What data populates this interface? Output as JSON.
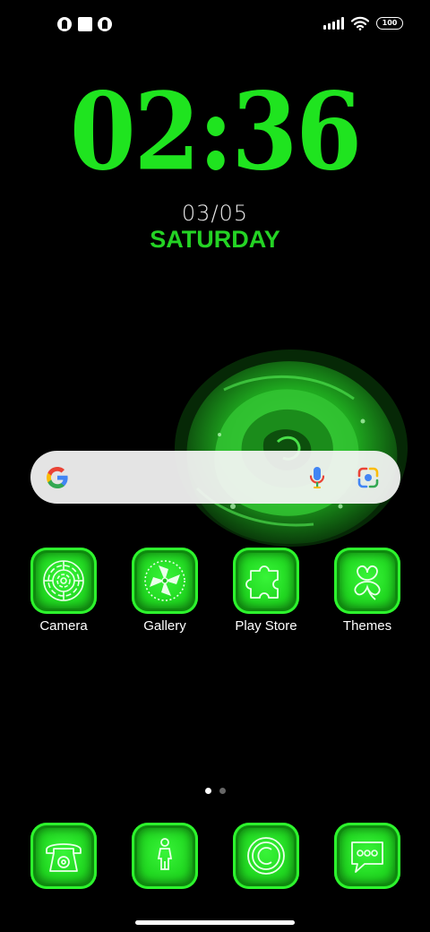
{
  "status_bar": {
    "battery_level": "100",
    "notification_icons": [
      "app-notification-icon",
      "square-notification-icon",
      "app-notification-icon"
    ],
    "signal_icon": "cellular-signal-icon",
    "wifi_icon": "wifi-icon"
  },
  "lockscreen_widget": {
    "time": "02:36",
    "date": "03/05",
    "weekday": "SATURDAY"
  },
  "search_widget": {
    "logo": "google-g-icon",
    "voice_icon": "microphone-icon",
    "lens_icon": "google-lens-icon"
  },
  "apps": [
    {
      "label": "Camera",
      "icon": "camera-icon"
    },
    {
      "label": "Gallery",
      "icon": "gallery-icon"
    },
    {
      "label": "Play Store",
      "icon": "puzzle-piece-icon"
    },
    {
      "label": "Themes",
      "icon": "clover-icon"
    }
  ],
  "dock": [
    {
      "icon": "phone-icon"
    },
    {
      "icon": "contacts-icon"
    },
    {
      "icon": "browser-icon"
    },
    {
      "icon": "messages-icon"
    }
  ],
  "page_indicator": {
    "pages": 2,
    "current": 1
  },
  "colors": {
    "accent_green": "#1fe41f",
    "background": "#000000",
    "search_bar": "#f5f5f5"
  }
}
